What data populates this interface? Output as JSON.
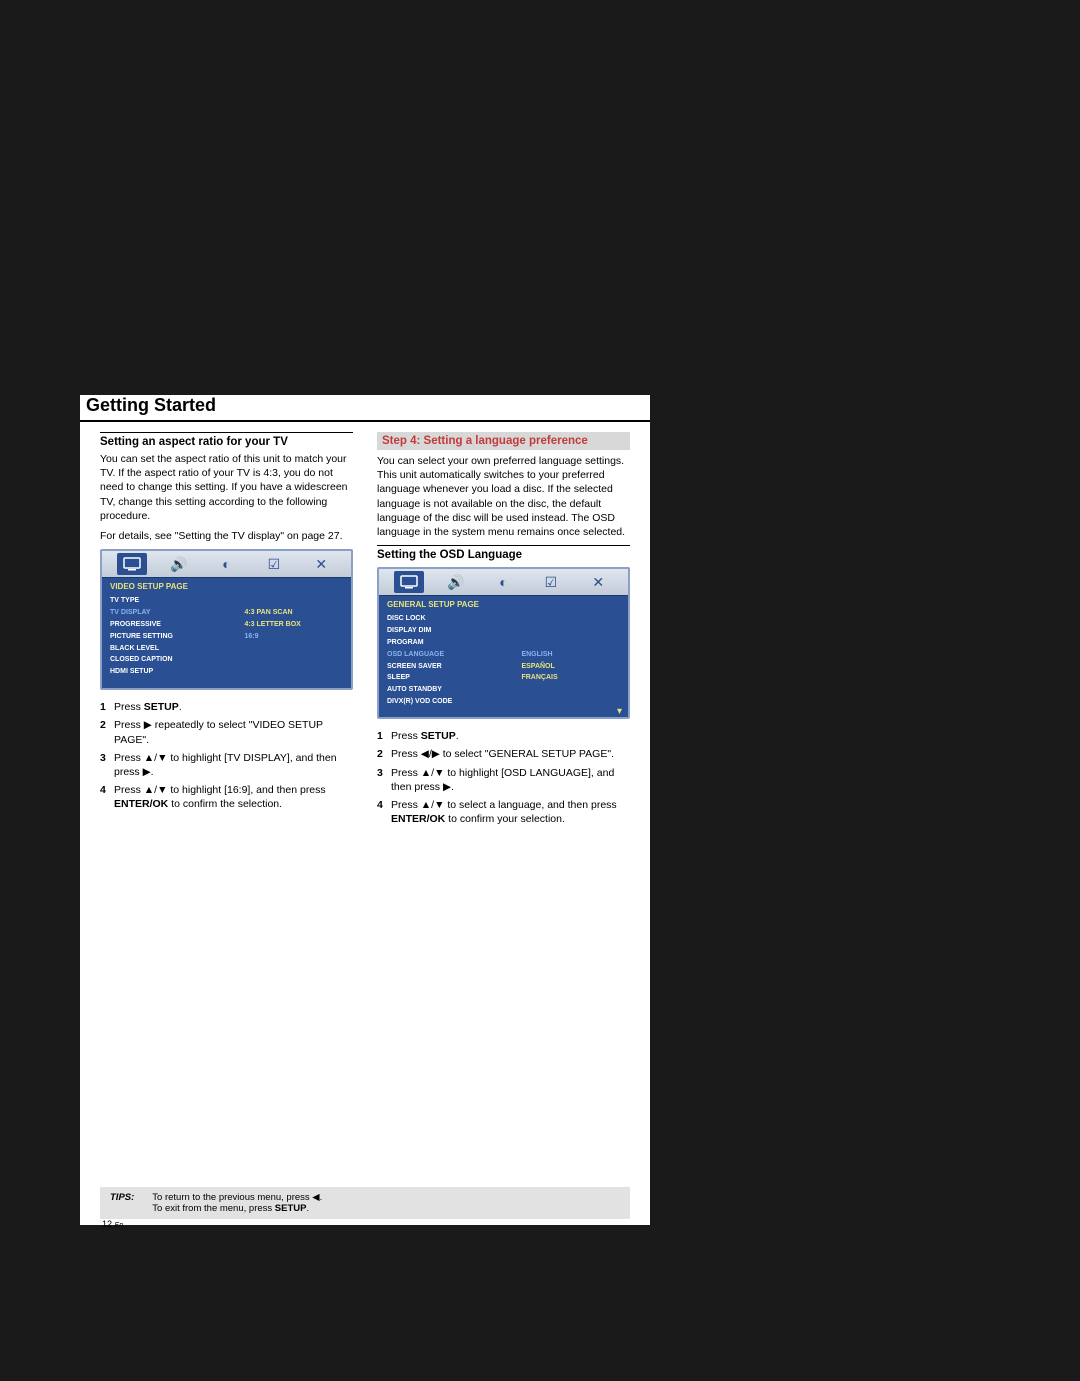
{
  "page_title": "Getting Started",
  "left": {
    "heading": "Setting an aspect ratio for your TV",
    "para1": "You can set the aspect ratio of this unit to match your TV. If the aspect ratio of your TV is 4:3, you do not need to change this setting. If you have a widescreen TV, change this setting according to the following procedure.",
    "para2": "For details, see \"Setting the TV display\" on page 27.",
    "osd": {
      "header": "VIDEO SETUP PAGE",
      "left_items": [
        "TV TYPE",
        "TV DISPLAY",
        "PROGRESSIVE",
        "PICTURE SETTING",
        "BLACK LEVEL",
        "CLOSED CAPTION",
        "HDMI SETUP"
      ],
      "right_items": [
        "4:3 PAN SCAN",
        "4:3 LETTER BOX",
        "16:9"
      ]
    },
    "steps": [
      {
        "pre": "Press ",
        "bold": "SETUP",
        "post": "."
      },
      {
        "text": "Press ▶ repeatedly to select \"VIDEO SETUP PAGE\"."
      },
      {
        "text": "Press ▲/▼ to highlight [TV DISPLAY], and then press ▶."
      },
      {
        "pre": "Press ▲/▼ to highlight [16:9], and then press ",
        "bold": "ENTER/OK",
        "post": " to confirm the selection."
      }
    ]
  },
  "right": {
    "heading": "Step 4: Setting a language preference",
    "para": "You can select your own preferred language settings. This unit automatically switches to your preferred language whenever you load a disc. If the selected language is not available on the disc, the default language of the disc will be used instead. The OSD language in the system menu remains once selected.",
    "sub_heading": "Setting the OSD Language",
    "osd": {
      "header": "GENERAL SETUP PAGE",
      "left_items": [
        "DISC LOCK",
        "DISPLAY DIM",
        "PROGRAM",
        "OSD LANGUAGE",
        "SCREEN SAVER",
        "SLEEP",
        "AUTO STANDBY",
        "DIVX(R) VOD CODE"
      ],
      "right_items": [
        "ENGLISH",
        "ESPAÑOL",
        "FRANÇAIS"
      ]
    },
    "steps": [
      {
        "pre": "Press ",
        "bold": "SETUP",
        "post": "."
      },
      {
        "text": "Press ◀/▶ to select \"GENERAL SETUP PAGE\"."
      },
      {
        "text": "Press ▲/▼ to highlight [OSD LANGUAGE], and then press ▶."
      },
      {
        "pre": "Press ▲/▼ to select a language, and then press ",
        "bold": "ENTER/OK",
        "post": " to confirm your selection."
      }
    ]
  },
  "tips": {
    "label": "TIPS:",
    "line1": "To return to the previous menu, press ◀.",
    "line2": "To exit from the menu, press ",
    "line2_bold": "SETUP",
    "line2_post": "."
  },
  "page_number": "12",
  "page_lang": "En"
}
